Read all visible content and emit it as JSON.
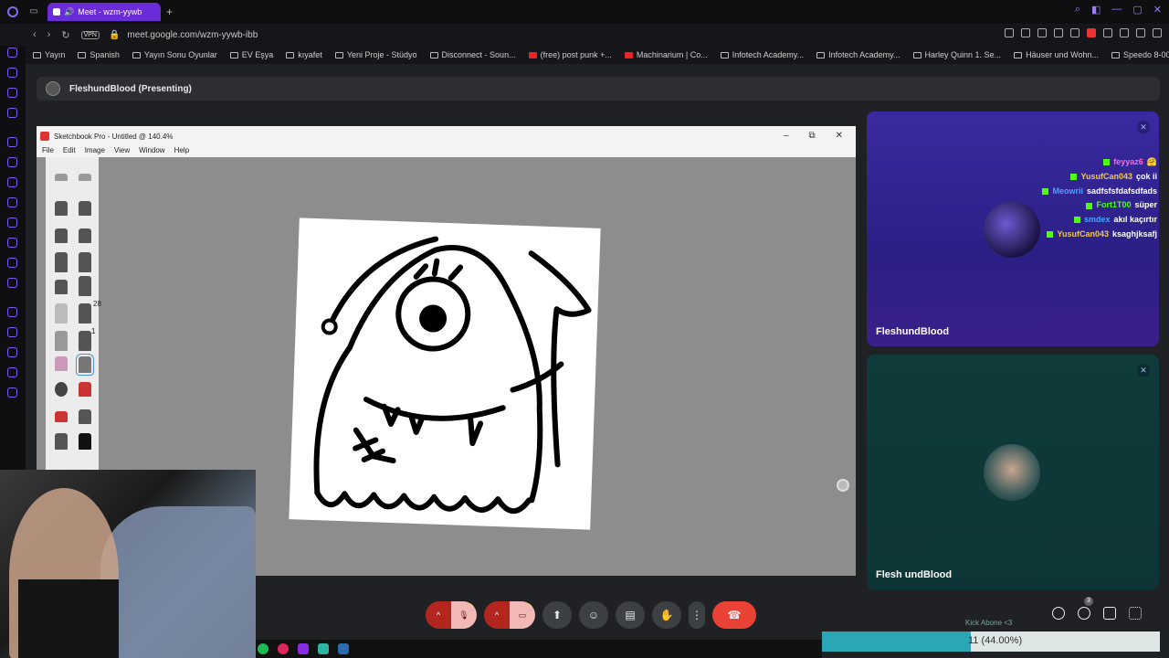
{
  "browser": {
    "tab_title": "Meet - wzm-yywb",
    "url": "meet.google.com/wzm-yywb-ibb",
    "vpn_label": "VPN"
  },
  "bookmarks": [
    {
      "label": "Yayın",
      "icon": "folder-icon"
    },
    {
      "label": "Spanish",
      "icon": "folder-icon"
    },
    {
      "label": "Yayın Sonu Oyunlar",
      "icon": "folder-icon"
    },
    {
      "label": "EV Eşya",
      "icon": "folder-icon"
    },
    {
      "label": "kıyafet",
      "icon": "folder-icon"
    },
    {
      "label": "Yeni Proje - Stüdyo",
      "icon": "app-icon"
    },
    {
      "label": "Disconnect - Soun...",
      "icon": "link-icon"
    },
    {
      "label": "(free) post punk +...",
      "icon": "youtube-icon"
    },
    {
      "label": "Machinarium | Co...",
      "icon": "youtube-icon"
    },
    {
      "label": "Infotech Academy...",
      "icon": "site-icon"
    },
    {
      "label": "Infotech Academy...",
      "icon": "site-icon"
    },
    {
      "label": "Harley Quinn 1. Se...",
      "icon": "site-icon"
    },
    {
      "label": "Häuser und Wohn...",
      "icon": "site-icon"
    },
    {
      "label": "Speedo 8-00494...",
      "icon": "site-icon"
    }
  ],
  "presenter": {
    "label": "FleshundBlood (Presenting)"
  },
  "sketchbook": {
    "title": "Sketchbook Pro - Untitled @ 140.4%",
    "menu": [
      "File",
      "Edit",
      "Image",
      "View",
      "Window",
      "Help"
    ],
    "brush_size_a": "28",
    "brush_size_b": "1"
  },
  "tiles": [
    {
      "name": "FleshundBlood"
    },
    {
      "name": "Flesh undBlood"
    }
  ],
  "chat": [
    {
      "user": "feyyaz6",
      "message": "🤗",
      "color": "#ff6ad5"
    },
    {
      "user": "YusufCan043",
      "message": "çok ii",
      "color": "#f2c94c"
    },
    {
      "user": "Meowrii",
      "message": "sadfsfsfdafsdfads",
      "color": "#4aa3ff"
    },
    {
      "user": "Fort1T00",
      "message": "süper",
      "color": "#53fc18"
    },
    {
      "user": "smdex",
      "message": "akıl kaçırtır",
      "color": "#4aa3ff"
    },
    {
      "user": "YusufCan043",
      "message": "ksaghjksafj",
      "color": "#f2c94c"
    }
  ],
  "controls": {
    "participants_count": "3",
    "warn_mark": "!"
  },
  "kick_goal": {
    "label": "Kick Abone <3",
    "progress_text": "11 (44.00%)",
    "progress_fraction": 0.44
  }
}
